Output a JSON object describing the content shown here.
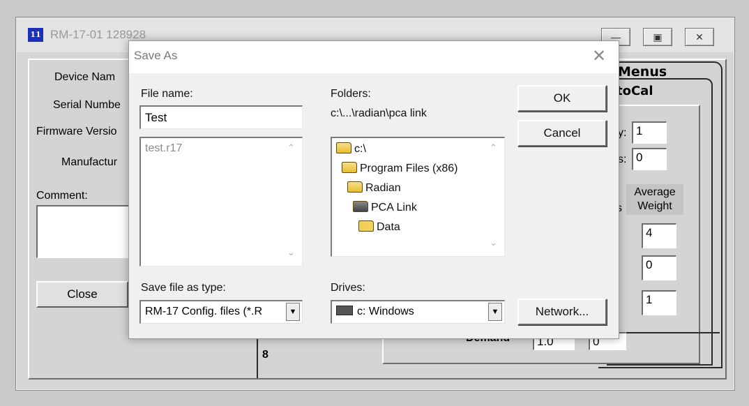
{
  "background_window": {
    "title": "RM-17-01 128928",
    "labels": {
      "device_name": "Device Nam",
      "serial_number": "Serial Numbe",
      "firmware_version": "Firmware Versio",
      "manufacturer": "Manufactur",
      "comment": "Comment:"
    },
    "close_button": "Close",
    "tabs": {
      "menus": "Menus",
      "autocal": "toCal"
    },
    "fields": {
      "field1": "1",
      "field2": "0",
      "avg1": "4",
      "avg2": "0",
      "avg3": "1",
      "demand1": "1.0",
      "demand2": "0"
    },
    "average_weight_header": "Average\nWeight",
    "partial_label_s": "s",
    "demand_label": "Demand",
    "bottom_tab_label": "8"
  },
  "dialog": {
    "title": "Save As",
    "file_name_label": "File name:",
    "file_name_value": "Test",
    "files": [
      "test.r17"
    ],
    "folders_label": "Folders:",
    "folders_path": "c:\\...\\radian\\pca link",
    "folder_tree": [
      {
        "name": "c:\\",
        "level": 0,
        "icon": "open-folder-icon"
      },
      {
        "name": "Program Files (x86)",
        "level": 1,
        "icon": "open-folder-icon"
      },
      {
        "name": "Radian",
        "level": 2,
        "icon": "open-folder-icon"
      },
      {
        "name": "PCA Link",
        "level": 3,
        "icon": "open-folder-selected-icon"
      },
      {
        "name": "Data",
        "level": 4,
        "icon": "closed-folder-icon"
      }
    ],
    "ok_label": "OK",
    "cancel_label": "Cancel",
    "save_type_label": "Save file as type:",
    "save_type_value": "RM-17 Config. files (*.R",
    "drives_label": "Drives:",
    "drive_value": "c: Windows",
    "network_label": "Network..."
  }
}
